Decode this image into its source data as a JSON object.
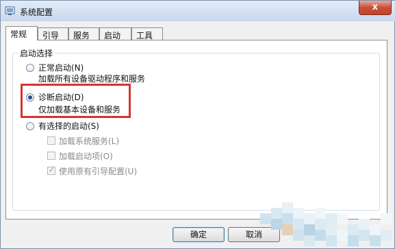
{
  "window": {
    "title": "系统配置",
    "close_glyph": "x"
  },
  "tabs": [
    {
      "label": "常规",
      "active": true
    },
    {
      "label": "引导",
      "active": false
    },
    {
      "label": "服务",
      "active": false
    },
    {
      "label": "启动",
      "active": false
    },
    {
      "label": "工具",
      "active": false
    }
  ],
  "startup": {
    "group_label": "启动选择",
    "normal": {
      "label": "正常启动(N)",
      "desc": "加载所有设备驱动程序和服务",
      "selected": false
    },
    "diagnostic": {
      "label": "诊断启动(D)",
      "desc": "仅加载基本设备和服务",
      "selected": true
    },
    "selective": {
      "label": "有选择的启动(S)",
      "selected": false,
      "options": [
        {
          "label": "加载系统服务(L)",
          "checked": false
        },
        {
          "label": "加载启动项(O)",
          "checked": false
        },
        {
          "label": "使用原有引导配置(U)",
          "checked": true
        }
      ]
    }
  },
  "buttons": {
    "ok": "确定",
    "cancel": "取消"
  },
  "colors": {
    "highlight": "#d43333",
    "title_bar": "#c8d8ec",
    "close": "#c7503a"
  }
}
